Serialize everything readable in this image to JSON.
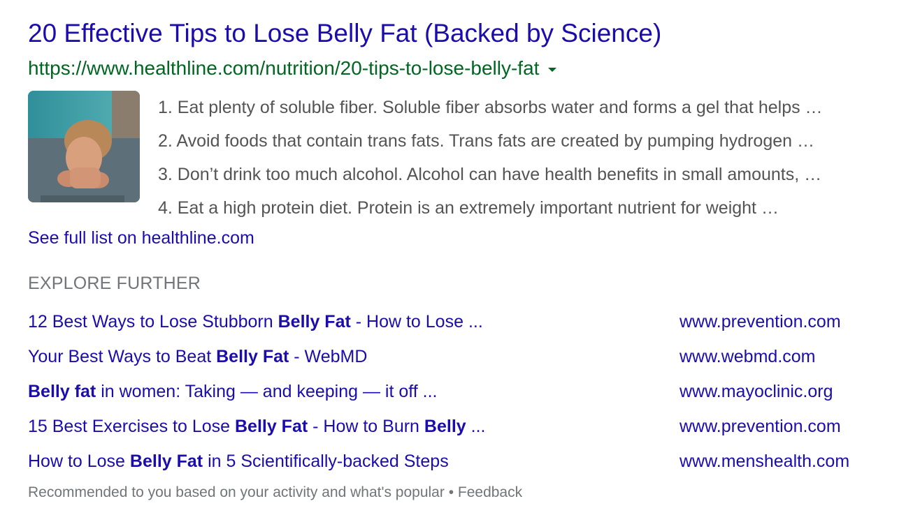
{
  "result": {
    "title": "20 Effective Tips to Lose Belly Fat (Backed by Science)",
    "url": "https://www.healthline.com/nutrition/20-tips-to-lose-belly-fat",
    "list": [
      "1. Eat plenty of soluble fiber. Soluble fiber absorbs water and forms a gel that helps …",
      "2. Avoid foods that contain trans fats. Trans fats are created by pumping hydrogen …",
      "3. Don’t drink too much alcohol. Alcohol can have health benefits in small amounts, …",
      "4. Eat a high protein diet. Protein is an extremely important nutrient for weight …"
    ],
    "see_full": "See full list on healthline.com"
  },
  "explore": {
    "heading": "EXPLORE FURTHER",
    "items": [
      {
        "parts": [
          {
            "text": "12 Best Ways to Lose Stubborn ",
            "bold": false
          },
          {
            "text": "Belly Fat",
            "bold": true
          },
          {
            "text": " - How to Lose ...",
            "bold": false
          }
        ],
        "site": "www.prevention.com"
      },
      {
        "parts": [
          {
            "text": "Your Best Ways to Beat ",
            "bold": false
          },
          {
            "text": "Belly Fat",
            "bold": true
          },
          {
            "text": " - WebMD",
            "bold": false
          }
        ],
        "site": "www.webmd.com"
      },
      {
        "parts": [
          {
            "text": "Belly fat",
            "bold": true
          },
          {
            "text": " in women: Taking — and keeping — it off ...",
            "bold": false
          }
        ],
        "site": "www.mayoclinic.org"
      },
      {
        "parts": [
          {
            "text": "15 Best Exercises to Lose ",
            "bold": false
          },
          {
            "text": "Belly Fat",
            "bold": true
          },
          {
            "text": " - How to Burn ",
            "bold": false
          },
          {
            "text": "Belly",
            "bold": true
          },
          {
            "text": " ...",
            "bold": false
          }
        ],
        "site": "www.prevention.com"
      },
      {
        "parts": [
          {
            "text": "How to Lose ",
            "bold": false
          },
          {
            "text": "Belly Fat",
            "bold": true
          },
          {
            "text": " in 5 Scientifically-backed Steps",
            "bold": false
          }
        ],
        "site": "www.menshealth.com"
      }
    ]
  },
  "footer": {
    "text": "Recommended to you based on your activity and what's popular",
    "separator": " • ",
    "feedback": "Feedback"
  },
  "colors": {
    "link": "#1a0dab",
    "url": "#006621",
    "snippet": "#545454",
    "muted": "#70757a"
  },
  "icons": {
    "thumbnail": "yoga-stretch-thumbnail",
    "caret": "caret-down-icon"
  }
}
